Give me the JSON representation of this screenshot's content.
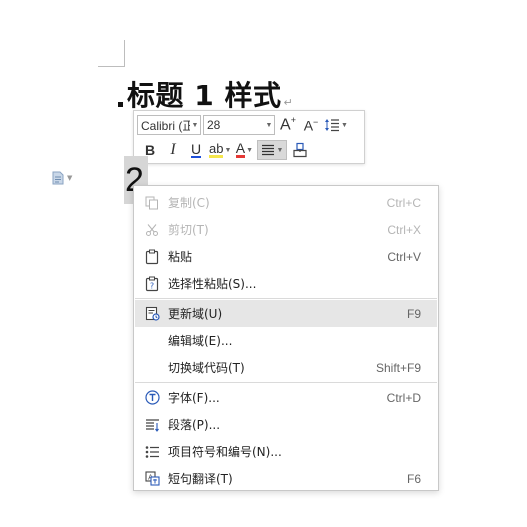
{
  "document": {
    "heading_text": "标题 1 样式",
    "para_mark": "↵",
    "number_text": "2"
  },
  "minibar": {
    "font_name": "Calibri (正",
    "font_size": "28",
    "grow_font": "A",
    "shrink_font": "A",
    "bold": "B",
    "italic": "I",
    "underline": "U",
    "highlight": "ab",
    "font_color": "A",
    "colors": {
      "highlight": "#f5e64c",
      "font_color": "#e53935",
      "underline": "#1d4ed8"
    }
  },
  "context_menu": {
    "items": [
      {
        "label": "复制(C)",
        "shortcut": "Ctrl+C",
        "icon": "copy-icon",
        "enabled": false
      },
      {
        "label": "剪切(T)",
        "shortcut": "Ctrl+X",
        "icon": "scissors-icon",
        "enabled": false
      },
      {
        "label": "粘贴",
        "shortcut": "Ctrl+V",
        "icon": "paste-icon",
        "enabled": true
      },
      {
        "label": "选择性粘贴(S)...",
        "shortcut": "",
        "icon": "paste-special-icon",
        "enabled": true
      },
      {
        "label": "更新域(U)",
        "shortcut": "F9",
        "icon": "update-field-icon",
        "enabled": true,
        "highlighted": true
      },
      {
        "label": "编辑域(E)...",
        "shortcut": "",
        "icon": "",
        "enabled": true
      },
      {
        "label": "切换域代码(T)",
        "shortcut": "Shift+F9",
        "icon": "",
        "enabled": true
      },
      {
        "label": "字体(F)...",
        "shortcut": "Ctrl+D",
        "icon": "font-icon",
        "enabled": true
      },
      {
        "label": "段落(P)...",
        "shortcut": "",
        "icon": "paragraph-icon",
        "enabled": true
      },
      {
        "label": "项目符号和编号(N)...",
        "shortcut": "",
        "icon": "bullet-list-icon",
        "enabled": true
      },
      {
        "label": "短句翻译(T)",
        "shortcut": "F6",
        "icon": "translate-icon",
        "enabled": true
      }
    ]
  }
}
